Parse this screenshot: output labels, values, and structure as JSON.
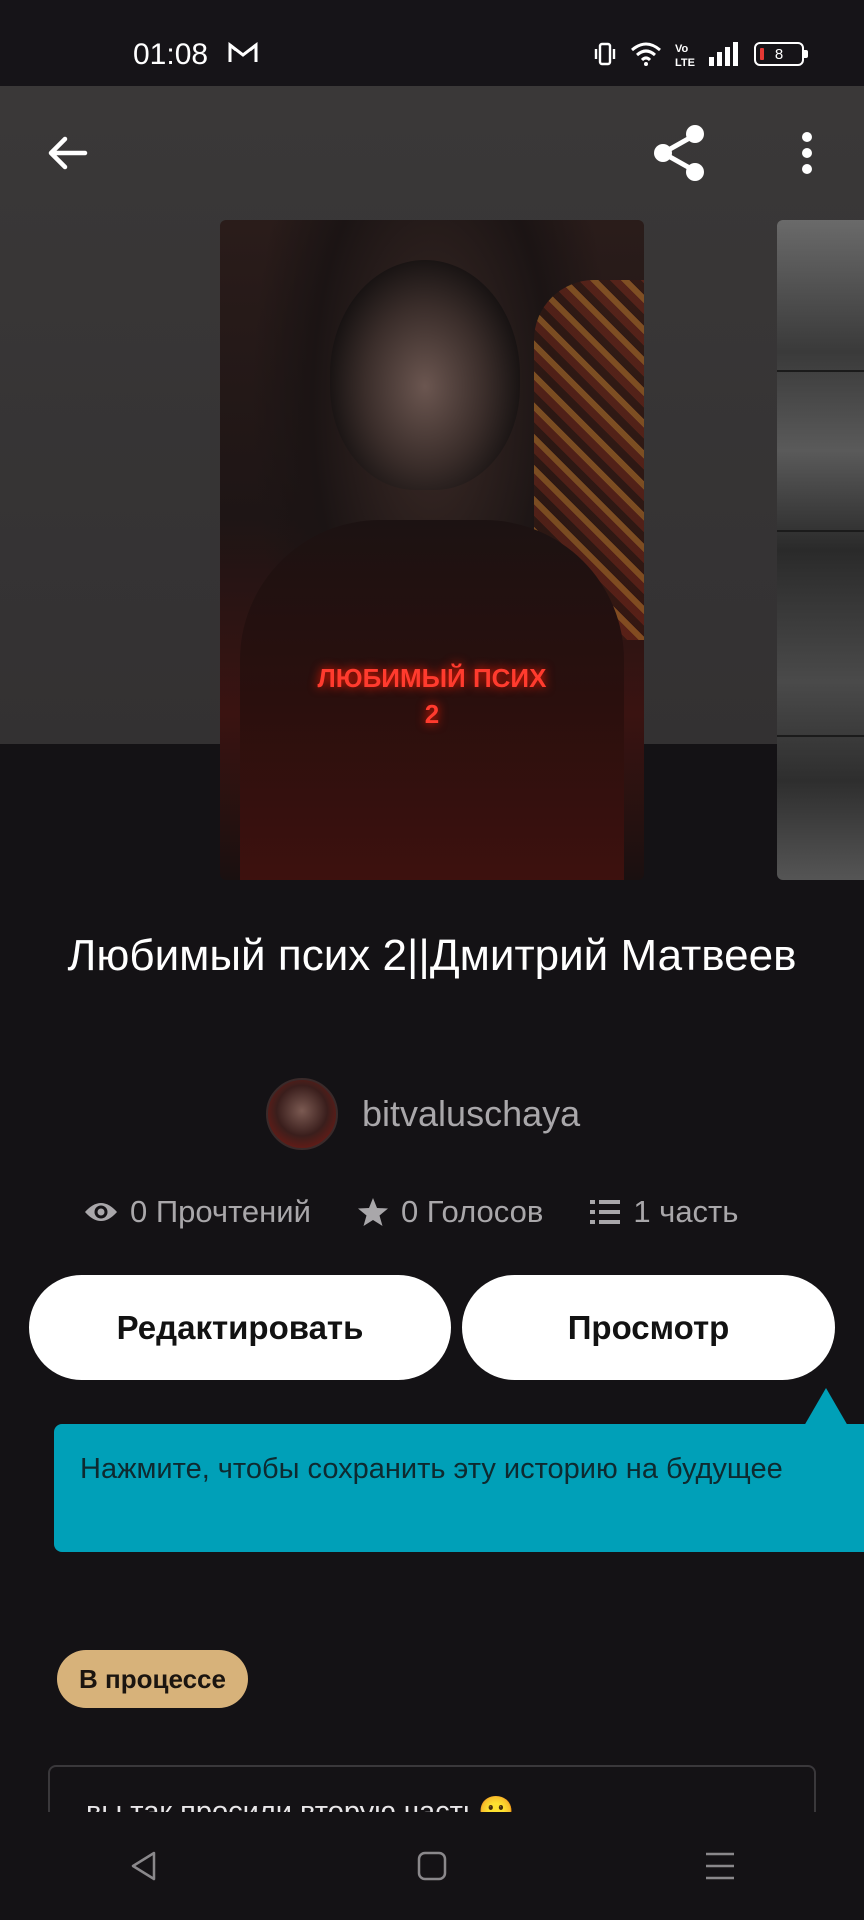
{
  "status_bar": {
    "time": "01:08",
    "battery": "8",
    "icons": [
      "gmail-icon",
      "vibrate-icon",
      "wifi-icon",
      "volte-icon",
      "signal-icon",
      "battery-icon"
    ]
  },
  "toolbar": {
    "back_icon": "arrow-left-icon",
    "share_icon": "share-icon",
    "more_icon": "more-vertical-icon"
  },
  "cover": {
    "title_line1": "ЛЮБИМЫЙ ПСИХ",
    "title_line2": "2"
  },
  "story": {
    "title": "Любимый псих 2||Дмитрий Матвеев",
    "author": "bitvaluschaya"
  },
  "stats": {
    "reads": "0 Прочтений",
    "votes": "0 Голосов",
    "parts": "1 часть"
  },
  "actions": {
    "edit_label": "Редактировать",
    "view_label": "Просмотр"
  },
  "tooltip": {
    "text": "Нажмите, чтобы сохранить эту историю на будущее"
  },
  "status_badge": "В процессе",
  "description": "вы так просили вторую часть🙁",
  "colors": {
    "background": "#141215",
    "hero": "#363434",
    "tooltip": "#00a0b8",
    "badge": "#d7b27a",
    "button": "#ffffff",
    "muted_text": "#a9a7aa"
  },
  "nav": {
    "back": "nav-back-icon",
    "home": "nav-home-icon",
    "recents": "nav-menu-icon"
  }
}
